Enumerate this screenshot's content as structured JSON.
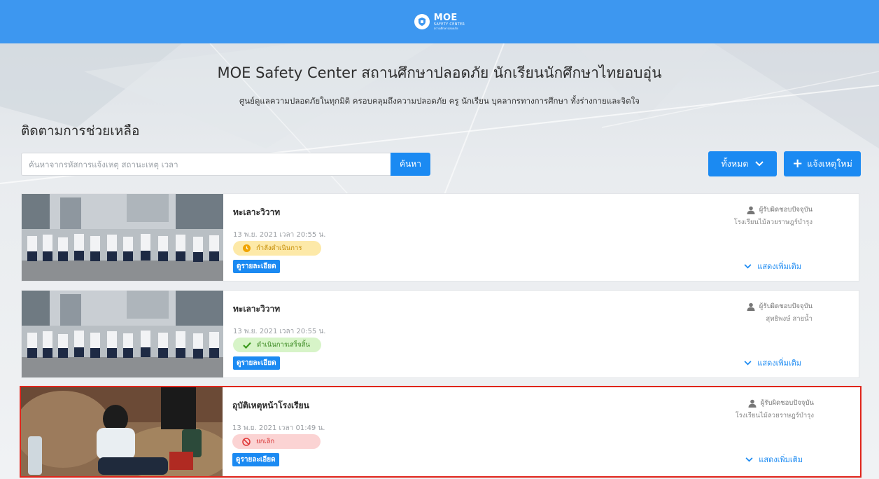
{
  "header": {
    "logo_main": "MOE",
    "logo_sub": "SAFETY CENTER",
    "logo_sub2": "สถานศึกษาปลอดภัย"
  },
  "hero": {
    "title": "MOE Safety Center สถานศึกษาปลอดภัย นักเรียนนักศึกษาไทยอบอุ่น",
    "subtitle": "ศูนย์ดูแลความปลอดภัยในทุกมิติ ครอบคลุมถึงความปลอดภัย ครู นักเรียน บุคลากรทางการศึกษา ทั้งร่างกายและจิตใจ"
  },
  "section_title": "ติดตามการช่วยเหลือ",
  "search": {
    "placeholder": "ค้นหาจากรหัสการแจ้งเหตุ สถานะเหตุ เวลา",
    "button_label": "ค้นหา"
  },
  "filter": {
    "label": "ทั้งหมด"
  },
  "new_report": {
    "label": "แจ้งเหตุใหม่"
  },
  "colors": {
    "primary": "#1b8af2",
    "topbar": "#3d97f0",
    "pending": "#fde9a8",
    "done": "#d7f4c8",
    "cancel": "#fbd3d3",
    "selected_border": "#e0251b"
  },
  "cards": [
    {
      "title": "ทะเลาะวิวาท",
      "date": "13 พ.ย. 2021 เวลา 20:55 น.",
      "status": "กำลังดำเนินการ",
      "status_icon": "clock-icon",
      "detail_label": "ดูรายละเอียด",
      "responsible_label": "ผู้รับผิดชอบปัจจุบัน",
      "responsible_name": "โรงเรียนไม้ลวยราษฎร์บำรุง",
      "more_label": "แสดงเพิ่มเติม"
    },
    {
      "title": "ทะเลาะวิวาท",
      "date": "13 พ.ย. 2021 เวลา 20:55 น.",
      "status": "ดำเนินการเสร็จสิ้น",
      "status_icon": "check-icon",
      "detail_label": "ดูรายละเอียด",
      "responsible_label": "ผู้รับผิดชอบปัจจุบัน",
      "responsible_name": "สุทธิพงษ์ สายน้ำ",
      "more_label": "แสดงเพิ่มเติม"
    },
    {
      "title": "อุบัติเหตุหน้าโรงเรียน",
      "date": "13 พ.ย. 2021 เวลา 01:49 น.",
      "status": "ยกเลิก",
      "status_icon": "ban-icon",
      "detail_label": "ดูรายละเอียด",
      "responsible_label": "ผู้รับผิดชอบปัจจุบัน",
      "responsible_name": "โรงเรียนไม้ลวยราษฎร์บำรุง",
      "more_label": "แสดงเพิ่มเติม"
    }
  ]
}
